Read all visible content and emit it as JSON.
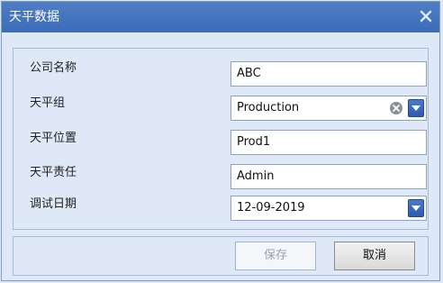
{
  "window": {
    "title": "天平数据"
  },
  "form": {
    "company": {
      "label": "公司名称",
      "value": "ABC"
    },
    "group": {
      "label": "天平组",
      "value": "Production"
    },
    "location": {
      "label": "天平位置",
      "value": "Prod1"
    },
    "responsible": {
      "label": "天平责任",
      "value": "Admin"
    },
    "debug_date": {
      "label": "调试日期",
      "value": "12-09-2019"
    }
  },
  "buttons": {
    "save": "保存",
    "cancel": "取消"
  },
  "icons": {
    "close": "close-icon",
    "clear": "clear-icon",
    "dropdown": "chevron-down-icon"
  },
  "colors": {
    "titlebar": "#4f7ec6",
    "background": "#dfe8f6",
    "accent": "#2c5ab0"
  }
}
